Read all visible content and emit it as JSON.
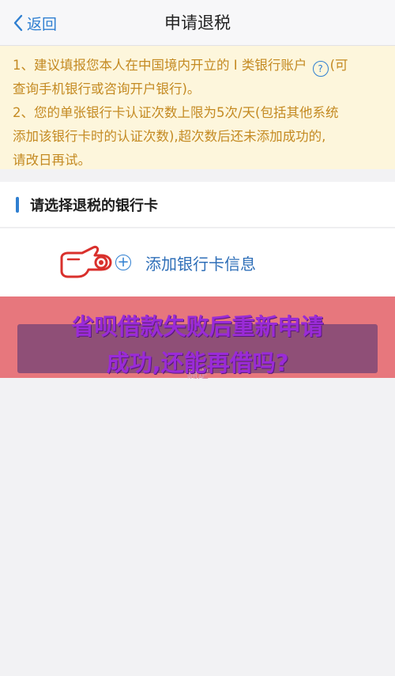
{
  "navbar": {
    "back_label": "返回",
    "title": "申请退税"
  },
  "notice": {
    "line1a": "1、建议填报您本人在中国境内开立的 I 类银行账户",
    "line1b": "(可",
    "line2": "查询手机银行或咨询开户银行)。",
    "line3": "2、您的单张银行卡认证次数上限为5次/天(包括其他系统",
    "line4": "添加该银行卡时的认证次数),超次数后还未添加成功的,",
    "line5": "请改日再试。",
    "help_icon": "?"
  },
  "card_section": {
    "header": "请选择退税的银行卡",
    "add_label": "添加银行卡信息",
    "add_icon": "+"
  },
  "overlay": {
    "headline_line1": "省呗借款失败后重新申请",
    "headline_line2": "成功,还能再借吗?",
    "confirm_label": "确定"
  },
  "colors": {
    "accent": "#2f7fd1",
    "notice_text": "#c48a22",
    "notice_bg": "#fdf6dc",
    "overlay_bg": "#e7777d",
    "headline": "#9a2bd7",
    "hand_red": "#d9302c"
  }
}
